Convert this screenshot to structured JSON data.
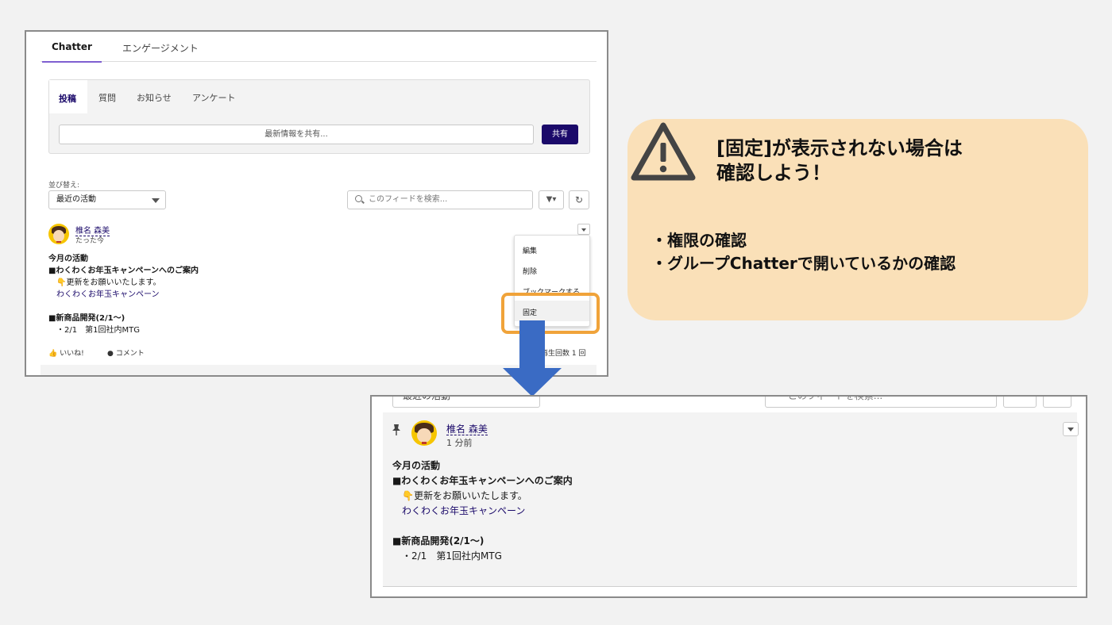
{
  "top": {
    "main_tabs": [
      "Chatter",
      "エンゲージメント"
    ],
    "composer_tabs": [
      "投稿",
      "質問",
      "お知らせ",
      "アンケート"
    ],
    "composer_placeholder": "最新情報を共有...",
    "share_label": "共有",
    "sort_label": "並び替え:",
    "sort_value": "最近の活動",
    "search_placeholder": "このフィードを検索...",
    "filter_label": "▼▾",
    "refresh_label": "↻",
    "post": {
      "author": "椎名 森美",
      "time": "たった今",
      "line1": "今月の活動",
      "line2": "■わくわくお年玉キャンペーンへのご案内",
      "line3": "👇更新をお願いいたします。",
      "link": "わくわくお年玉キャンペーン",
      "line4": "■新商品開発(2/1〜)",
      "line5": "・2/1　第1回社内MTG"
    },
    "menu": [
      "編集",
      "削除",
      "ブックマークする",
      "固定"
    ],
    "like_label": "いいね!",
    "comment_label": "コメント",
    "views_label": "再生回数 1 回"
  },
  "callout": {
    "title_line1": "[固定]が表示されない場合は",
    "title_line2": "確認しよう！",
    "item1": "・権限の確認",
    "item2": "・グループChatterで開いているかの確認",
    "bg_color": "#fae0b8"
  },
  "bottom": {
    "sort_value": "最近の活動",
    "search_placeholder": "このフィードを検索...",
    "post": {
      "author": "椎名 森美",
      "time": "1 分前",
      "line1": "今月の活動",
      "line2": "■わくわくお年玉キャンペーンへのご案内",
      "line3": "👇更新をお願いいたします。",
      "link": "わくわくお年玉キャンペーン",
      "line4": "■新商品開発(2/1〜)",
      "line5": "・2/1　第1回社内MTG"
    }
  },
  "colors": {
    "brand": "#1b0a6a",
    "highlight": "#f0a33a",
    "arrow": "#3a6bc4"
  }
}
